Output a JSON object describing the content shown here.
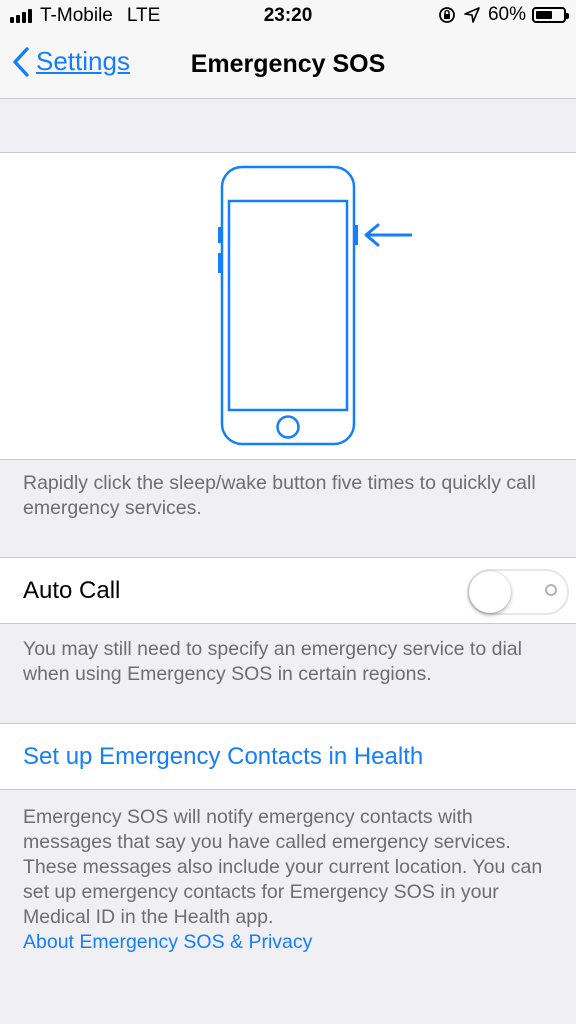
{
  "status_bar": {
    "carrier": "T-Mobile",
    "network": "LTE",
    "time": "23:20",
    "battery_percent": "60%",
    "battery_level": 0.6
  },
  "nav": {
    "back_label": "Settings",
    "title": "Emergency SOS"
  },
  "illustration": {
    "icon": "iphone-side-button-icon",
    "accent_color": "#157efb"
  },
  "sos_description": "Rapidly click the sleep/wake button five times to quickly call emergency services.",
  "auto_call": {
    "label": "Auto Call",
    "enabled": false
  },
  "auto_call_footer": "You may still need to specify an emergency service to dial when using Emergency SOS in certain regions.",
  "contacts_link": "Set up Emergency Contacts in Health",
  "contacts_footer": {
    "text": "Emergency SOS will notify emergency contacts with messages that say you have called emergency services. These messages also include your current location. You can set up emergency contacts for Emergency SOS in your Medical ID in the Health app.",
    "privacy_link": "About Emergency SOS & Privacy"
  },
  "colors": {
    "accent": "#157efb",
    "background": "#efeff4",
    "footer_text": "#6d6d72"
  }
}
